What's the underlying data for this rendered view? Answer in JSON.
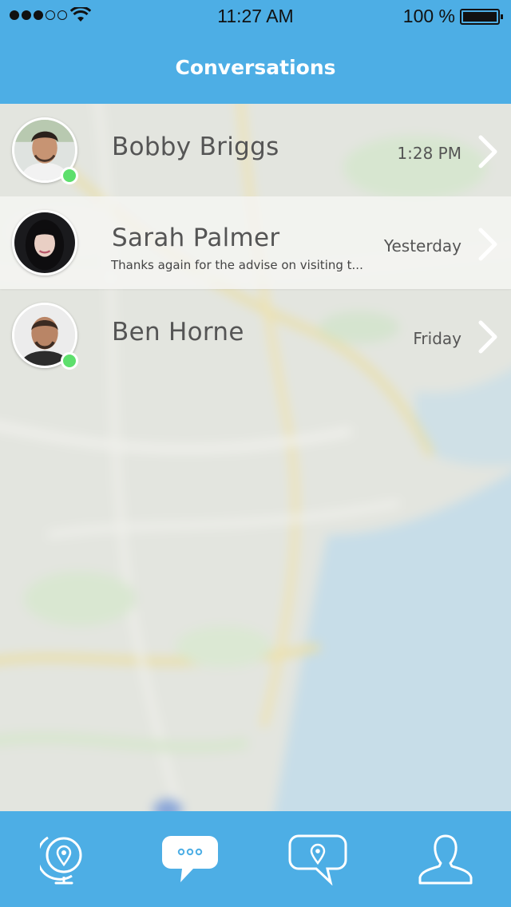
{
  "status_bar": {
    "time": "11:27 AM",
    "battery": "100 %",
    "signal_bars": 3
  },
  "nav": {
    "title": "Conversations"
  },
  "conversations": [
    {
      "name": "Bobby Briggs",
      "time": "1:28 PM",
      "preview": "",
      "online": true,
      "selected": false
    },
    {
      "name": "Sarah Palmer",
      "time": "Yesterday",
      "preview": "Thanks again for the advise on visiting t...",
      "online": false,
      "selected": true
    },
    {
      "name": "Ben Horne",
      "time": "Friday",
      "preview": "",
      "online": true,
      "selected": false
    }
  ],
  "tabs": [
    {
      "icon": "globe-pin-icon",
      "active": false
    },
    {
      "icon": "chat-bubble-icon",
      "active": true
    },
    {
      "icon": "location-bubble-icon",
      "active": false
    },
    {
      "icon": "profile-icon",
      "active": false
    }
  ],
  "colors": {
    "accent": "#4daee5",
    "online": "#5ddf6c",
    "text": "#555555"
  }
}
